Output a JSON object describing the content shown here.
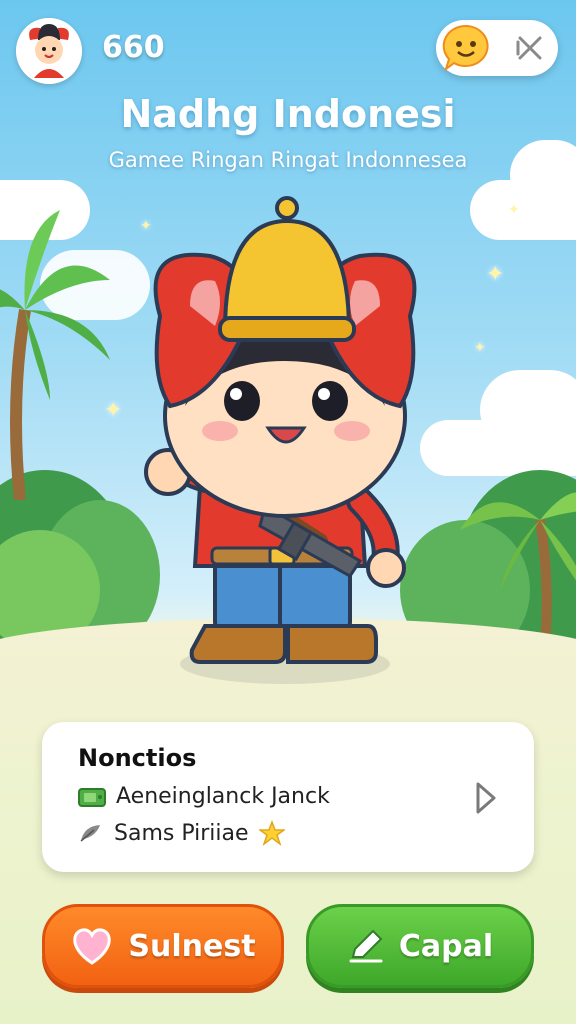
{
  "hud": {
    "score": "660",
    "avatar_icon": "character-avatar-icon",
    "chat_icon": "smiley-chat-icon",
    "close_icon": "close-icon"
  },
  "header": {
    "title": "Nadhg Indonesi",
    "subtitle": "Gamee Ringan Ringat Indonnesea"
  },
  "info_card": {
    "title": "Nonctios",
    "items": [
      {
        "label": "Aeneinglanck Janck",
        "icon": "cash-icon"
      },
      {
        "label": "Sams Piriiae",
        "icon": "feather-icon",
        "badge_icon": "star-icon"
      }
    ],
    "arrow_icon": "chevron-right-icon"
  },
  "buttons": {
    "left": {
      "label": "Sulnest",
      "icon": "heart-icon",
      "color": "#f26a17"
    },
    "right": {
      "label": "Capal",
      "icon": "pencil-icon",
      "color": "#46b030"
    }
  },
  "colors": {
    "sky": "#6cc7ef",
    "accent_orange": "#f26a17",
    "accent_green": "#46b030"
  }
}
